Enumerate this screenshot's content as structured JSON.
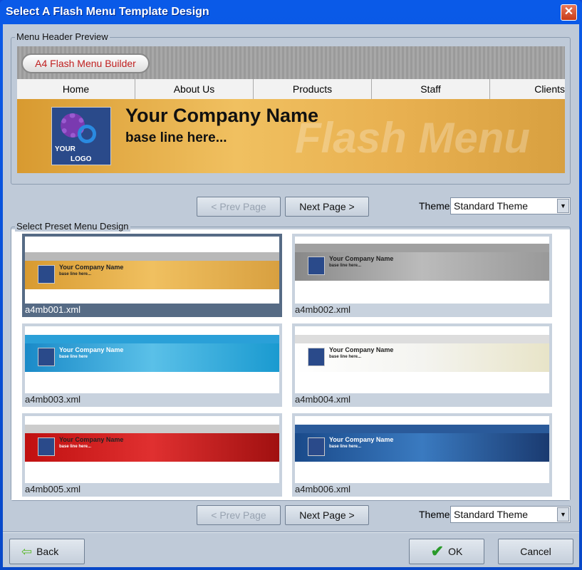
{
  "window": {
    "title": "Select A Flash Menu Template Design",
    "close_icon": "close-icon"
  },
  "preview_group": {
    "label": "Menu Header Preview",
    "app_badge": "A4 Flash Menu Builder",
    "nav": [
      "Home",
      "About Us",
      "Products",
      "Staff",
      "Clients"
    ],
    "company_name": "Your Company Name",
    "base_line": "base line here...",
    "logo_text": [
      "YOUR",
      "LOGO"
    ],
    "watermark": "Flash Menu"
  },
  "top_pager": {
    "prev": "< Prev Page",
    "next": "Next Page >",
    "theme_label": "Theme",
    "theme_value": "Standard Theme"
  },
  "preset_group": {
    "label": "Select Preset Menu Design",
    "templates": [
      {
        "file": "a4mb001.xml",
        "selected": true,
        "company_name": "Your Company Name",
        "base_line": "base line here..."
      },
      {
        "file": "a4mb002.xml",
        "selected": false,
        "company_name": "Your Company Name",
        "base_line": "base line here..."
      },
      {
        "file": "a4mb003.xml",
        "selected": false,
        "company_name": "Your Company Name",
        "base_line": "base line here"
      },
      {
        "file": "a4mb004.xml",
        "selected": false,
        "company_name": "Your Company Name",
        "base_line": "base line here..."
      },
      {
        "file": "a4mb005.xml",
        "selected": false,
        "company_name": "Your Company Name",
        "base_line": "base line here..."
      },
      {
        "file": "a4mb006.xml",
        "selected": false,
        "company_name": "Your Company Name",
        "base_line": "base line here..."
      }
    ]
  },
  "bottom_pager": {
    "prev": "< Prev Page",
    "next": "Next Page >",
    "theme_label": "Theme",
    "theme_value": "Standard Theme"
  },
  "footer": {
    "back": "Back",
    "ok": "OK",
    "cancel": "Cancel"
  },
  "colors": {
    "titlebar": "#0a5ae8",
    "selected": "#566b85",
    "ok_check": "#2a9a2a",
    "back_arrow": "#5ab82a"
  }
}
